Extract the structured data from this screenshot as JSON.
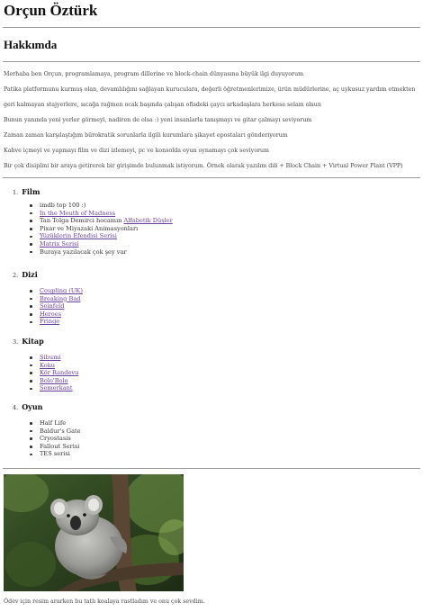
{
  "page": {
    "title": "Orçun Öztürk"
  },
  "about": {
    "heading": "Hakkımda",
    "paragraphs": [
      "Merhaba ben Orçun, programlamaya, program dillerine ve block-chain dünyasına büyük ilgi duyuyorum",
      "Patika platformunu kurmuş olan, devamlılığını sağlayan kuruculara, değerli öğretmenlerimize, ürün müdürlerine, aç uykusuz yardım etmekten",
      "geri kalmayan stajyerlere, sıcağa rağmen ocak başında çalışan ofisdeki çaycı arkadaşlara herkese selam olsun",
      "Bunun yanında yeni yerler görmeyi, nadiren de olsa :) yeni insanlarla tanışmayı ve gitar çalmayı seviyorum",
      "Zaman zaman karşılaştığım bürokratik sorunlarla ilgili kurumlara şikayet epostaları gönderiyorum",
      "Kahve içmeyi ve yapmayı film ve dizi izlemeyi, pc ve konsolda oyun oynamayı çok seviyorum",
      "Bir çok disiplini bir araya getirerek bir girişimde bulunmak istiyorum. Örnek olarak yazılım dili + Block Chain + Virtual Power Plant (VPP)"
    ]
  },
  "sections": {
    "film": {
      "number": "1.",
      "title": "Film",
      "items": {
        "imdb": "imdb top 100 :)",
        "mouth": "In the Mouth of Madness",
        "tan_prefix": "Tan Tolga Demirci hocamın ",
        "tan_link": "Alfabetik Düşler",
        "pixar": "Pixar ve Miyazaki Animasyonları",
        "lotr": "Yüzüklerin Efendisi Serisi",
        "matrix": "Matrix Serisi",
        "more": "Buraya yazılacak çok şey var"
      }
    },
    "dizi": {
      "number": "2.",
      "title": "Dizi",
      "items": [
        "Coupling (UK)",
        "Breaking Bad",
        "Seinfeld",
        "Heroes",
        "Fringe"
      ]
    },
    "kitap": {
      "number": "3.",
      "title": "Kitap",
      "items": [
        "Şibumi",
        "Koku",
        "Kör Randevu",
        "Bolo'Bolo",
        "Semerkant"
      ]
    },
    "oyun": {
      "number": "4.",
      "title": "Oyun",
      "items": [
        "Half Life",
        "Baldur's Gate",
        "Cryostasis",
        "Fallout Serisi",
        "TES serisi"
      ]
    }
  },
  "photo": {
    "subject": "koala-photo",
    "caption": "Ödev için resim ararken bu tatlı koalaya rastladım ve onu çok sevdim."
  },
  "colors": {
    "link": "#6a3fa0",
    "text": "#444444",
    "rule": "#9a9a9a"
  }
}
